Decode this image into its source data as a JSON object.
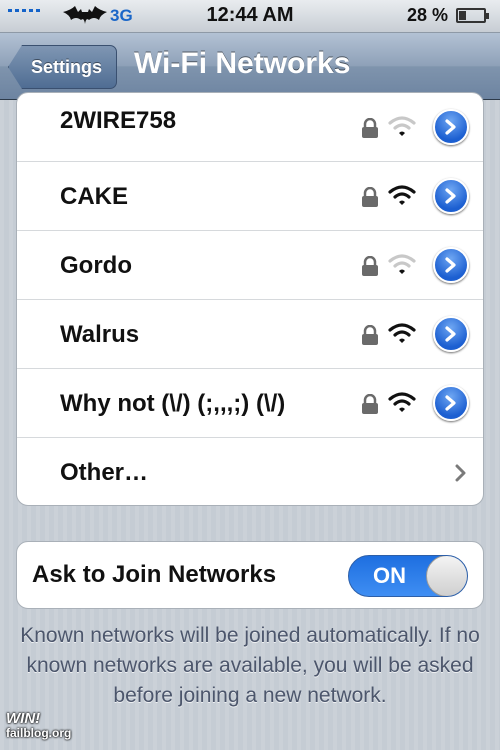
{
  "status_bar": {
    "network": "3G",
    "time": "12:44 AM",
    "battery_percent": "28 %",
    "battery_level": 0.28,
    "carrier_logo": "bat-logo-icon"
  },
  "nav": {
    "back_label": "Settings",
    "title": "Wi-Fi Networks"
  },
  "networks": [
    {
      "name": "2WIRE758",
      "secured": true,
      "signal": "low"
    },
    {
      "name": "CAKE",
      "secured": true,
      "signal": "full"
    },
    {
      "name": "Gordo",
      "secured": true,
      "signal": "low"
    },
    {
      "name": "Walrus",
      "secured": true,
      "signal": "full"
    },
    {
      "name": "Why not (\\/) (;,,,;) (\\/)",
      "secured": true,
      "signal": "full"
    }
  ],
  "other_label": "Other…",
  "ask_to_join": {
    "label": "Ask to Join Networks",
    "state_label": "ON",
    "enabled": true
  },
  "footer_note": "Known networks will be joined automatically. If no known networks are available, you will be asked before joining a new network.",
  "watermark": {
    "line1": "WIN!",
    "line2": "failblog.org"
  },
  "colors": {
    "accent_blue": "#1c5fd1",
    "toggle_on": "#2f7ff0",
    "nav_bar": "#7f94ad"
  }
}
